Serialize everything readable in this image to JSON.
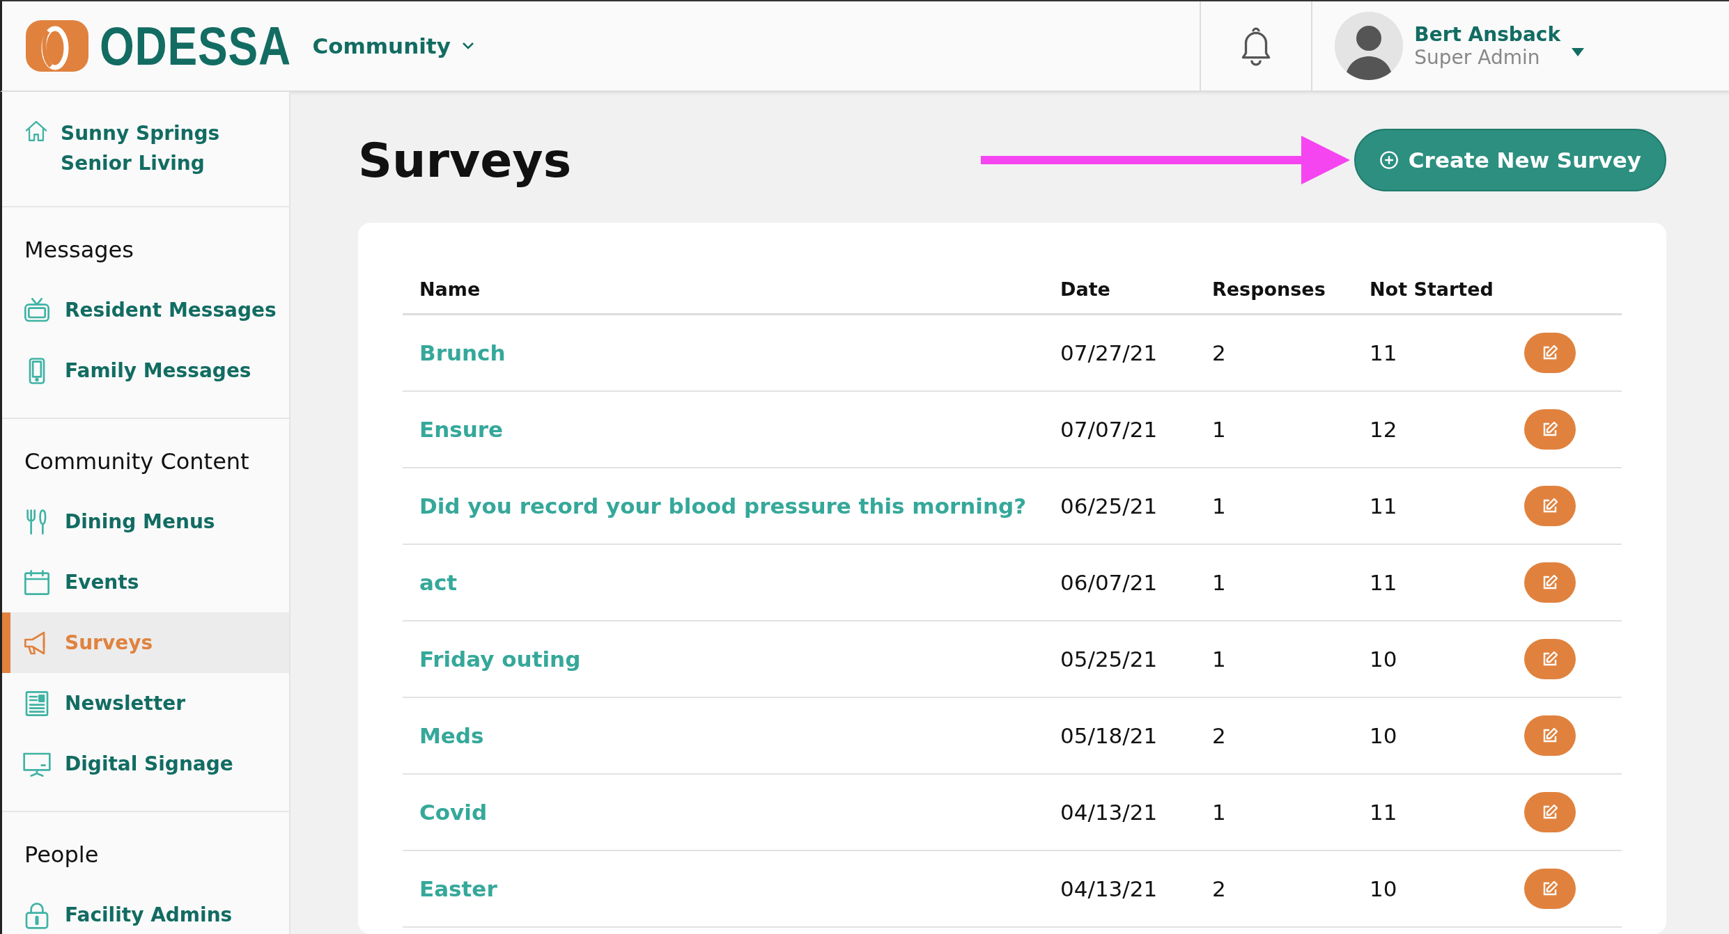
{
  "header": {
    "logo_text": "ODESSA",
    "community": "Community",
    "user": {
      "name": "Bert Ansback",
      "role": "Super Admin"
    }
  },
  "sidebar": {
    "organization": "Sunny Springs Senior Living",
    "sections": [
      {
        "title": "Messages",
        "items": [
          {
            "label": "Resident Messages",
            "kind": "tv",
            "selected": false
          },
          {
            "label": "Family Messages",
            "kind": "phone",
            "selected": false
          }
        ]
      },
      {
        "title": "Community Content",
        "items": [
          {
            "label": "Dining Menus",
            "kind": "utensils",
            "selected": false
          },
          {
            "label": "Events",
            "kind": "calendar",
            "selected": false
          },
          {
            "label": "Surveys",
            "kind": "megaphone",
            "selected": true
          },
          {
            "label": "Newsletter",
            "kind": "newsletter",
            "selected": false
          },
          {
            "label": "Digital Signage",
            "kind": "monitor",
            "selected": false
          }
        ]
      },
      {
        "title": "People",
        "items": [
          {
            "label": "Facility Admins",
            "kind": "lock",
            "selected": false
          }
        ]
      }
    ]
  },
  "page": {
    "title": "Surveys",
    "create_button": "Create New Survey"
  },
  "table": {
    "columns": [
      "Name",
      "Date",
      "Responses",
      "Not Started"
    ],
    "rows": [
      {
        "name": "Brunch",
        "date": "07/27/21",
        "responses": "2",
        "not_started": "11"
      },
      {
        "name": "Ensure",
        "date": "07/07/21",
        "responses": "1",
        "not_started": "12"
      },
      {
        "name": "Did you record your blood pressure this morning?",
        "date": "06/25/21",
        "responses": "1",
        "not_started": "11"
      },
      {
        "name": "act",
        "date": "06/07/21",
        "responses": "1",
        "not_started": "11"
      },
      {
        "name": "Friday outing",
        "date": "05/25/21",
        "responses": "1",
        "not_started": "10"
      },
      {
        "name": "Meds",
        "date": "05/18/21",
        "responses": "2",
        "not_started": "10"
      },
      {
        "name": "Covid",
        "date": "04/13/21",
        "responses": "1",
        "not_started": "11"
      },
      {
        "name": "Easter",
        "date": "04/13/21",
        "responses": "2",
        "not_started": "10"
      }
    ]
  }
}
